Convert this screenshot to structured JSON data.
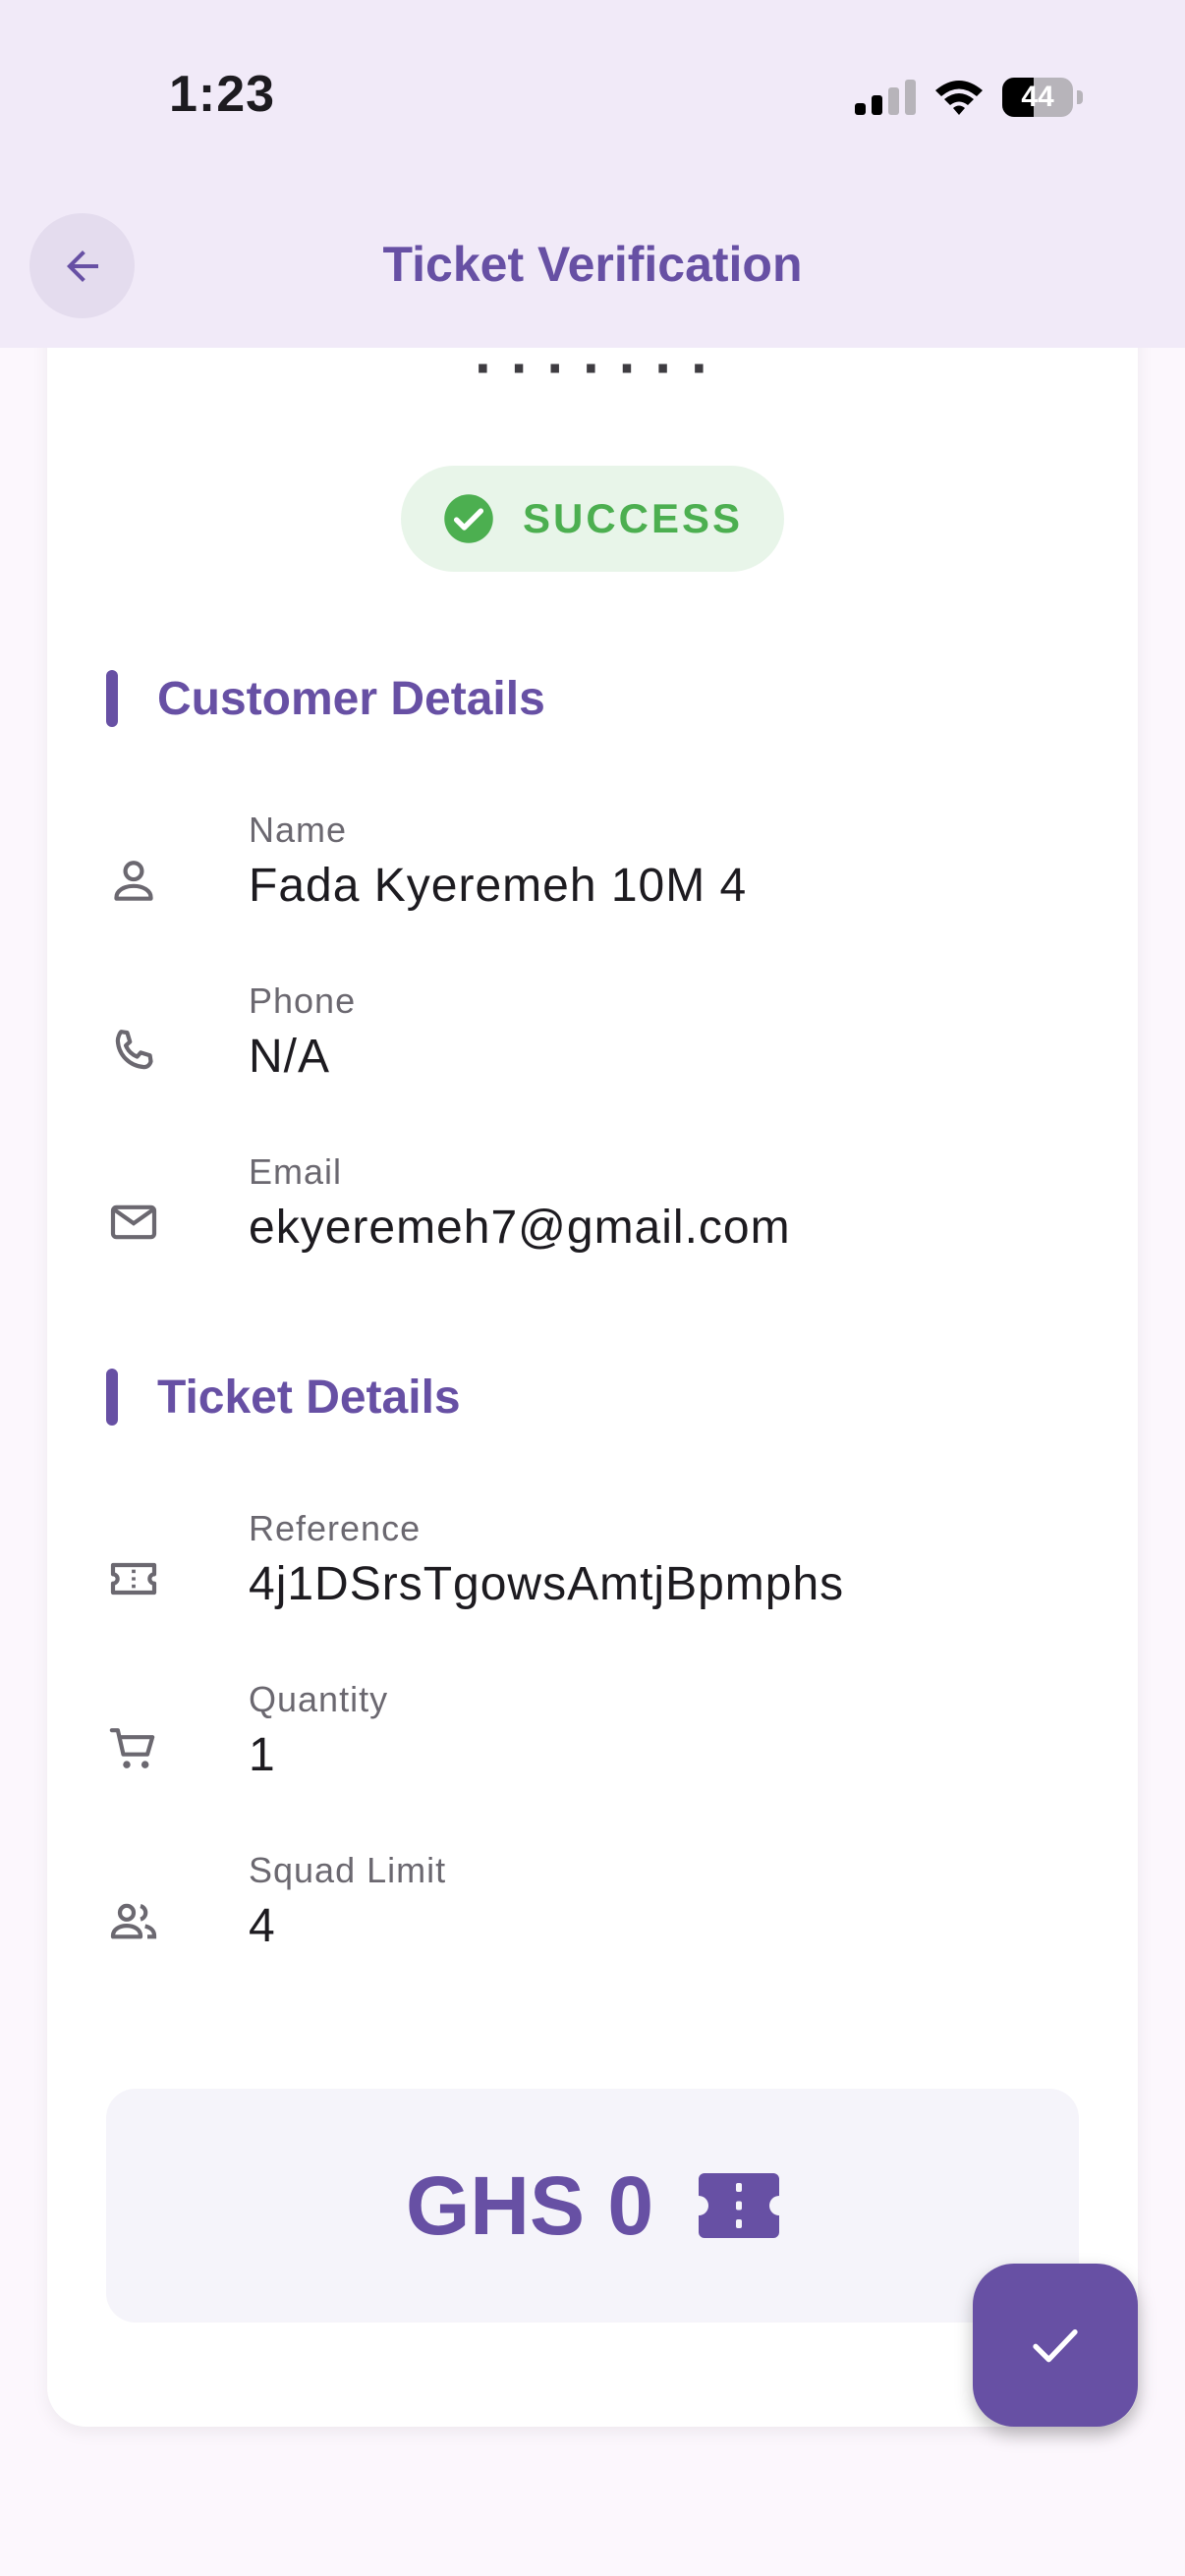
{
  "status_bar": {
    "time": "1:23",
    "battery": "44",
    "battery_level": 0.44
  },
  "header": {
    "title": "Ticket Verification"
  },
  "event": {
    "partial_title": "· · · ·  ·  · ·"
  },
  "status": {
    "label": "SUCCESS",
    "color": "#4caf50"
  },
  "customer": {
    "section_title": "Customer Details",
    "fields": [
      {
        "label": "Name",
        "value": "Fada Kyeremeh 10M 4",
        "icon": "person-icon"
      },
      {
        "label": "Phone",
        "value": "N/A",
        "icon": "phone-icon"
      },
      {
        "label": "Email",
        "value": "ekyeremeh7@gmail.com",
        "icon": "mail-icon"
      }
    ]
  },
  "ticket": {
    "section_title": "Ticket Details",
    "fields": [
      {
        "label": "Reference",
        "value": "4j1DSrsTgowsAmtjBpmphs",
        "icon": "ticket-icon"
      },
      {
        "label": "Quantity",
        "value": "1",
        "icon": "cart-icon"
      },
      {
        "label": "Squad Limit",
        "value": "4",
        "icon": "people-icon"
      }
    ]
  },
  "price": {
    "amount": "GHS 0"
  },
  "colors": {
    "primary": "#6750a4",
    "success": "#4caf50",
    "header_bg": "#f1eaf8"
  }
}
